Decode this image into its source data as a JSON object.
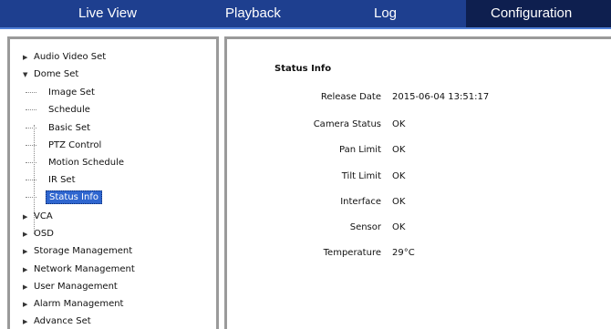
{
  "nav": {
    "tabs": [
      {
        "label": "Live View",
        "active": false
      },
      {
        "label": "Playback",
        "active": false
      },
      {
        "label": "Log",
        "active": false
      },
      {
        "label": "Configuration",
        "active": true
      }
    ]
  },
  "tree": {
    "audio_video_set": "Audio Video Set",
    "dome_set": "Dome Set",
    "dome_children": [
      "Image Set",
      "Schedule",
      "Basic Set",
      "PTZ Control",
      "Motion Schedule",
      "IR Set",
      "Status Info"
    ],
    "selected_child": "Status Info",
    "vca": "VCA",
    "osd": "OSD",
    "storage_management": "Storage Management",
    "network_management": "Network Management",
    "user_management": "User Management",
    "alarm_management": "Alarm Management",
    "advance_set": "Advance Set"
  },
  "status_info": {
    "title": "Status Info",
    "rows": [
      {
        "label": "Release Date",
        "value": "2015-06-04 13:51:17"
      },
      {
        "label": "Camera Status",
        "value": "OK"
      },
      {
        "label": "Pan Limit",
        "value": "OK"
      },
      {
        "label": "Tilt Limit",
        "value": "OK"
      },
      {
        "label": "Interface",
        "value": "OK"
      },
      {
        "label": "Sensor",
        "value": "OK"
      },
      {
        "label": "Temperature",
        "value": "29°C"
      }
    ]
  },
  "colors": {
    "nav_background": "#1e3f8f",
    "nav_active": "#0e1f4f",
    "selection": "#2f66cf",
    "panel_border": "#9a9a9a"
  }
}
